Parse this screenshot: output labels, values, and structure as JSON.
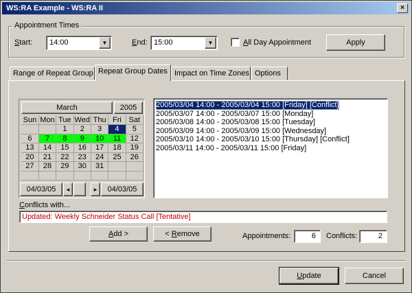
{
  "window": {
    "title": "WS:RA Example - WS:RA II",
    "close_symbol": "×"
  },
  "appointment_times": {
    "legend": "Appointment Times",
    "start_label_u": "S",
    "start_label_rest": "tart:",
    "start_value": "14:00",
    "end_label_u": "E",
    "end_label_rest": "nd:",
    "end_value": "15:00",
    "all_day_label_u": "A",
    "all_day_label_rest": "ll Day Appointment",
    "all_day_checked": false,
    "apply_label": "Apply"
  },
  "tabs": [
    {
      "label": "Range of Repeat Group"
    },
    {
      "label": "Repeat Group Dates"
    },
    {
      "label": "Impact on Time Zones"
    },
    {
      "label": "Options"
    }
  ],
  "calendar": {
    "month": "March",
    "year": "2005",
    "weekdays": [
      "Sun",
      "Mon",
      "Tue",
      "Wed",
      "Thu",
      "Fri",
      "Sat"
    ],
    "weeks": [
      [
        "",
        "",
        "1",
        "2",
        "3",
        "4",
        "5"
      ],
      [
        "6",
        "7",
        "8",
        "9",
        "10",
        "11",
        "12"
      ],
      [
        "13",
        "14",
        "15",
        "16",
        "17",
        "18",
        "19"
      ],
      [
        "20",
        "21",
        "22",
        "23",
        "24",
        "25",
        "26"
      ],
      [
        "27",
        "28",
        "29",
        "30",
        "31",
        "",
        ""
      ],
      [
        "",
        "",
        "",
        "",
        "",
        "",
        ""
      ]
    ],
    "selected_days": [
      "7",
      "8",
      "9",
      "10",
      "11"
    ],
    "focused_day": "4",
    "from_date": "04/03/05",
    "to_date": "04/03/05",
    "prev_symbol": "◂",
    "next_symbol": "▸"
  },
  "dates_list": [
    "2005/03/04 14:00 - 2005/03/04 15:00 [Friday] [Conflict]",
    "2005/03/07 14:00 - 2005/03/07 15:00 [Monday]",
    "2005/03/08 14:00 - 2005/03/08 15:00 [Tuesday]",
    "2005/03/09 14:00 - 2005/03/09 15:00 [Wednesday]",
    "2005/03/10 14:00 - 2005/03/10 15:00 [Thursday] [Conflict]",
    "2005/03/11 14:00 - 2005/03/11 15:00 [Friday]"
  ],
  "selected_index": 0,
  "conflicts": {
    "label_u": "C",
    "label_rest": "onflicts with...",
    "value": "Updated: Weekly Schneider Status Call [Tentative]",
    "value_color": "#c00000"
  },
  "actions": {
    "add_label_u": "A",
    "add_label_rest": "dd >",
    "remove_label_pre": "< ",
    "remove_label_u": "R",
    "remove_label_rest": "emove"
  },
  "counts": {
    "appointments_label": "Appointments:",
    "appointments_value": "6",
    "conflicts_label": "Conflicts:",
    "conflicts_value": "2"
  },
  "footer": {
    "update_label_u": "U",
    "update_label_rest": "pdate",
    "cancel_label": "Cancel"
  }
}
